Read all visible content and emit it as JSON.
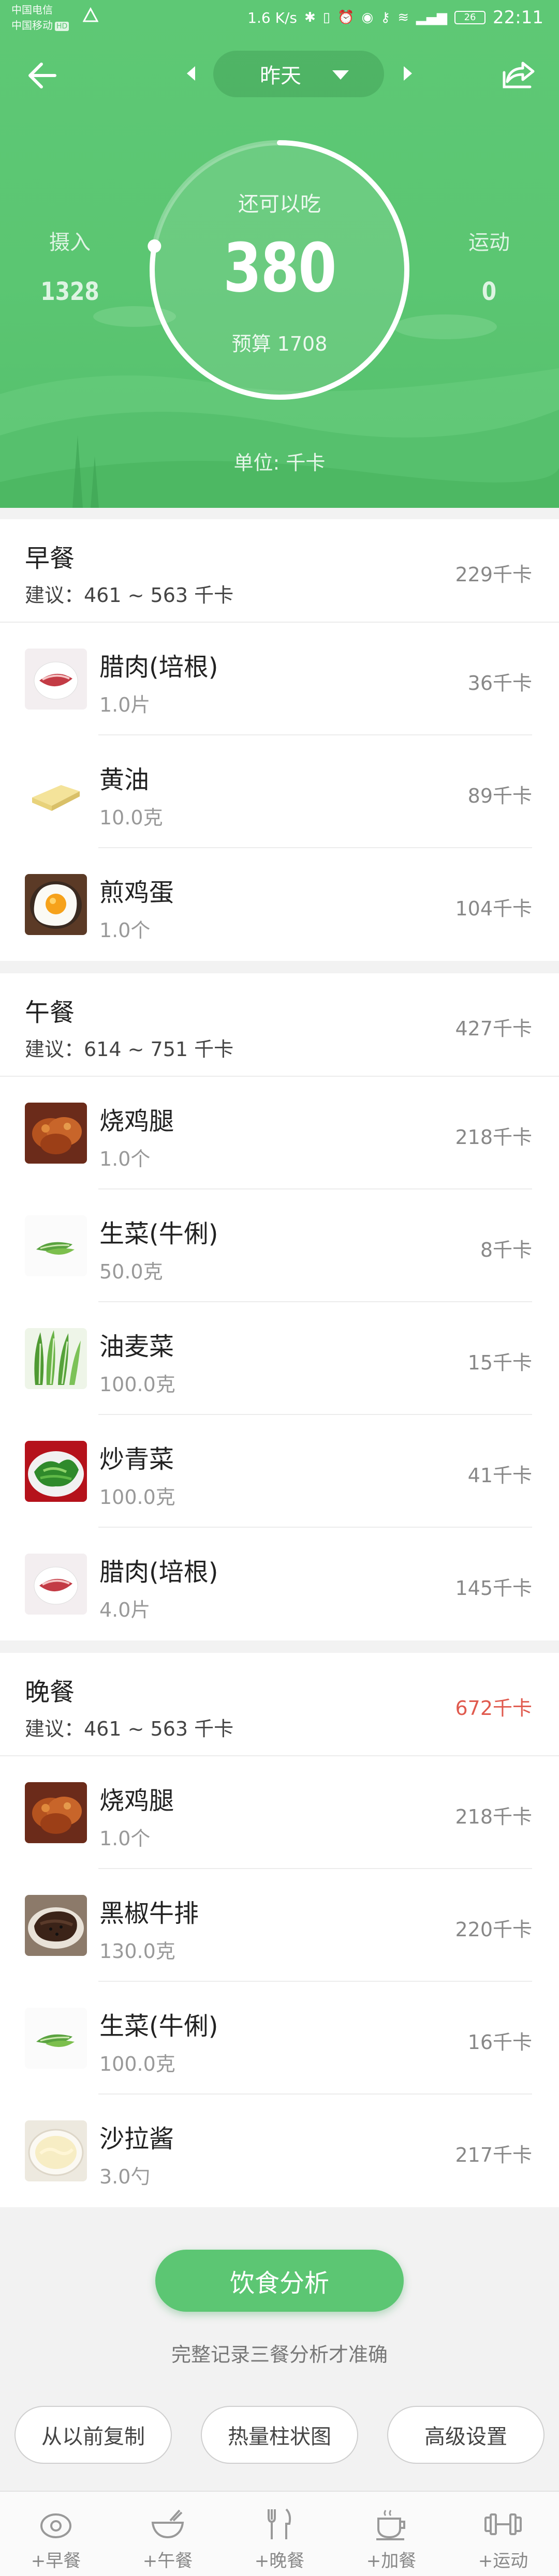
{
  "status_bar": {
    "carrier1": "中国电信",
    "carrier2": "中国移动",
    "hd_badge": "HD",
    "speed": "1.6 K/s",
    "battery": "26",
    "time": "22:11"
  },
  "nav": {
    "date_label": "昨天"
  },
  "summary": {
    "intake_label": "摄入",
    "intake_value": "1328",
    "remaining_label": "还可以吃",
    "remaining_value": "380",
    "budget_text": "预算 1708",
    "exercise_label": "运动",
    "exercise_value": "0",
    "unit_text": "单位: 千卡",
    "ring_progress": 0.78
  },
  "meals": [
    {
      "name": "早餐",
      "suggest": "建议：461 ~ 563 千卡",
      "total": "229千卡",
      "items": [
        {
          "name": "腊肉(培根)",
          "qty": "1.0片",
          "kcal": "36千卡",
          "icon": "bacon-icon"
        },
        {
          "name": "黄油",
          "qty": "10.0克",
          "kcal": "89千卡",
          "icon": "butter-icon"
        },
        {
          "name": "煎鸡蛋",
          "qty": "1.0个",
          "kcal": "104千卡",
          "icon": "fried-egg-icon"
        }
      ]
    },
    {
      "name": "午餐",
      "suggest": "建议：614 ~ 751 千卡",
      "total": "427千卡",
      "items": [
        {
          "name": "烧鸡腿",
          "qty": "1.0个",
          "kcal": "218千卡",
          "icon": "roast-chicken-icon"
        },
        {
          "name": "生菜(牛俐)",
          "qty": "50.0克",
          "kcal": "8千卡",
          "icon": "lettuce-icon"
        },
        {
          "name": "油麦菜",
          "qty": "100.0克",
          "kcal": "15千卡",
          "icon": "leaf-lettuce-icon"
        },
        {
          "name": "炒青菜",
          "qty": "100.0克",
          "kcal": "41千卡",
          "icon": "stir-fry-greens-icon"
        },
        {
          "name": "腊肉(培根)",
          "qty": "4.0片",
          "kcal": "145千卡",
          "icon": "bacon-icon"
        }
      ]
    },
    {
      "name": "晚餐",
      "suggest": "建议：461 ~ 563 千卡",
      "total": "672千卡",
      "items": [
        {
          "name": "烧鸡腿",
          "qty": "1.0个",
          "kcal": "218千卡",
          "icon": "roast-chicken-icon"
        },
        {
          "name": "黑椒牛排",
          "qty": "130.0克",
          "kcal": "220千卡",
          "icon": "steak-icon"
        },
        {
          "name": "生菜(牛俐)",
          "qty": "100.0克",
          "kcal": "16千卡",
          "icon": "lettuce-icon"
        },
        {
          "name": "沙拉酱",
          "qty": "3.0勺",
          "kcal": "217千卡",
          "icon": "mayo-icon"
        }
      ]
    }
  ],
  "actions": {
    "analyze_label": "饮食分析",
    "hint": "完整记录三餐分析才准确",
    "copy_label": "从以前复制",
    "chart_label": "热量柱状图",
    "settings_label": "高级设置"
  },
  "tabs": [
    {
      "label": "+早餐",
      "icon": "egg-icon"
    },
    {
      "label": "+午餐",
      "icon": "bowl-icon"
    },
    {
      "label": "+晚餐",
      "icon": "fork-knife-icon"
    },
    {
      "label": "+加餐",
      "icon": "cup-icon"
    },
    {
      "label": "+运动",
      "icon": "dumbbell-icon"
    }
  ],
  "colors": {
    "brand_green": "#5bc672",
    "over_red": "#e05a4e"
  }
}
